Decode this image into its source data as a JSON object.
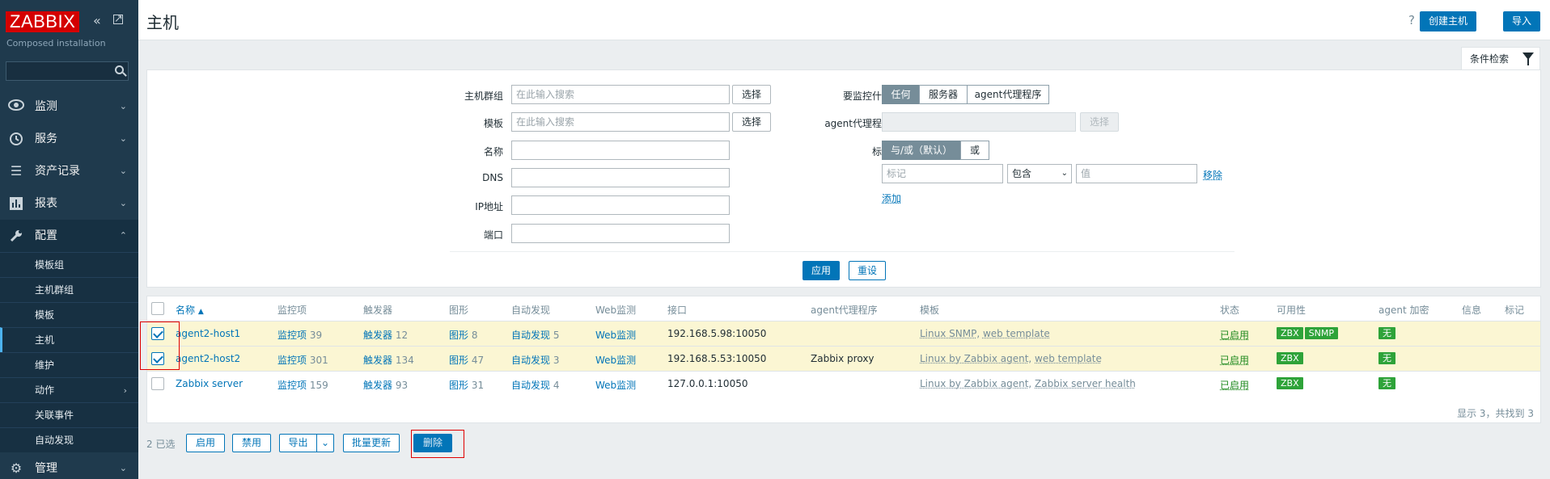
{
  "app": {
    "logo_text": "ZABBIX",
    "subtitle": "Composed installation",
    "brand_color": "#d40000",
    "accent_color": "#0275b8"
  },
  "sidebar": {
    "collapse_icon": "double-chevron-left-icon",
    "kiosk_icon": "expand-icon",
    "menu": [
      {
        "label": "监测",
        "icon": "eye-icon"
      },
      {
        "label": "服务",
        "icon": "clock-icon"
      },
      {
        "label": "资产记录",
        "icon": "list-icon"
      },
      {
        "label": "报表",
        "icon": "bar-chart-icon"
      },
      {
        "label": "配置",
        "icon": "wrench-icon"
      }
    ],
    "submenu": [
      {
        "label": "模板组"
      },
      {
        "label": "主机群组"
      },
      {
        "label": "模板"
      },
      {
        "label": "主机"
      },
      {
        "label": "维护"
      },
      {
        "label": "动作"
      },
      {
        "label": "关联事件"
      },
      {
        "label": "自动发现"
      }
    ],
    "admin_label": "管理"
  },
  "header": {
    "title": "主机",
    "help": "?",
    "create_host": "创建主机",
    "import": "导入"
  },
  "filter": {
    "tab_label": "条件检索",
    "host_groups_label": "主机群组",
    "host_groups_placeholder": "在此输入搜索",
    "templates_label": "模板",
    "templates_placeholder": "在此输入搜索",
    "select_label": "选择",
    "name_label": "名称",
    "dns_label": "DNS",
    "ip_label": "IP地址",
    "port_label": "端口",
    "monitored_by_label": "要监控什么",
    "monitored_by_options": [
      "任何",
      "服务器",
      "agent代理程序"
    ],
    "proxy_label": "agent代理程序",
    "tags_label": "标记",
    "tags_operator_options": [
      "与/或（默认）",
      "或"
    ],
    "tag_placeholder": "标记",
    "tag_operator": "包含",
    "value_placeholder": "值",
    "remove": "移除",
    "add": "添加",
    "apply": "应用",
    "reset": "重设"
  },
  "table": {
    "columns": [
      "名称",
      "监控项",
      "触发器",
      "图形",
      "自动发现",
      "Web监测",
      "接口",
      "agent代理程序",
      "模板",
      "状态",
      "可用性",
      "agent 加密",
      "信息",
      "标记"
    ],
    "rows": [
      {
        "checked": true,
        "name": "agent2-host1",
        "items_label": "监控项",
        "items_count": "39",
        "triggers_label": "触发器",
        "triggers_count": "12",
        "graphs_label": "图形",
        "graphs_count": "8",
        "discovery_label": "自动发现",
        "discovery_count": "5",
        "web": "Web监测",
        "interface": "192.168.5.98:10050",
        "proxy": "",
        "templates": [
          "Linux SNMP",
          "web template"
        ],
        "status": "已启用",
        "availability": [
          "ZBX",
          "SNMP"
        ],
        "encryption": "无"
      },
      {
        "checked": true,
        "name": "agent2-host2",
        "items_label": "监控项",
        "items_count": "301",
        "triggers_label": "触发器",
        "triggers_count": "134",
        "graphs_label": "图形",
        "graphs_count": "47",
        "discovery_label": "自动发现",
        "discovery_count": "3",
        "web": "Web监测",
        "interface": "192.168.5.53:10050",
        "proxy": "Zabbix proxy",
        "templates": [
          "Linux by Zabbix agent",
          "web template"
        ],
        "status": "已启用",
        "availability": [
          "ZBX"
        ],
        "encryption": "无"
      },
      {
        "checked": false,
        "name": "Zabbix server",
        "items_label": "监控项",
        "items_count": "159",
        "triggers_label": "触发器",
        "triggers_count": "93",
        "graphs_label": "图形",
        "graphs_count": "31",
        "discovery_label": "自动发现",
        "discovery_count": "4",
        "web": "Web监测",
        "interface": "127.0.0.1:10050",
        "proxy": "",
        "templates": [
          "Linux by Zabbix agent",
          "Zabbix server health"
        ],
        "status": "已启用",
        "availability": [
          "ZBX"
        ],
        "encryption": "无"
      }
    ],
    "footer": "显示 3，共找到 3"
  },
  "actions": {
    "selected": "2 已选",
    "enable": "启用",
    "disable": "禁用",
    "export": "导出",
    "mass_update": "批量更新",
    "delete": "删除"
  }
}
